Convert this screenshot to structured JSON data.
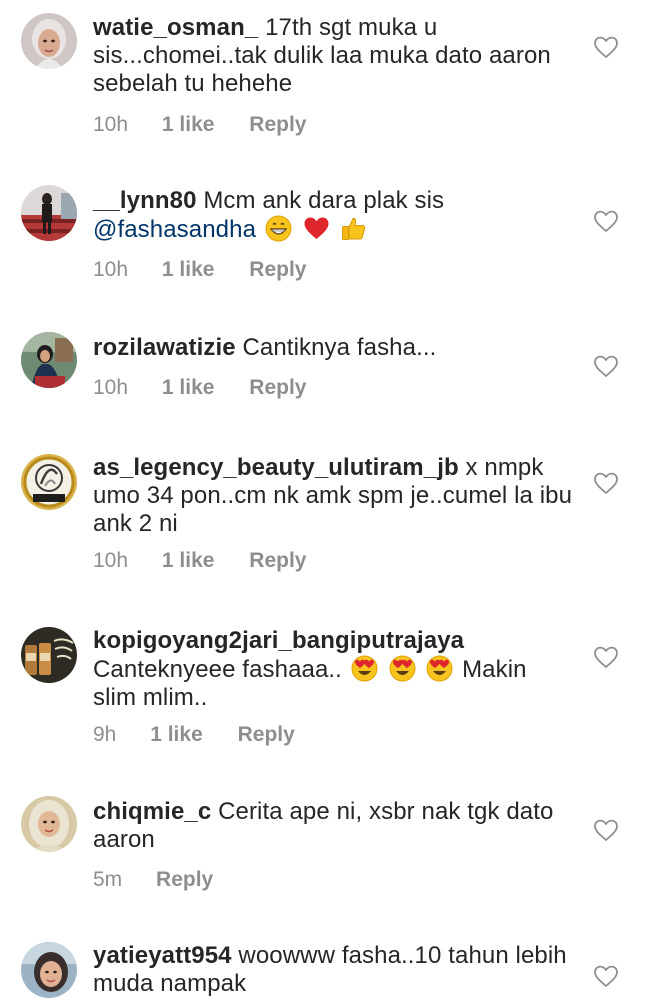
{
  "icons": {
    "heart_outline": "heart-outline-icon",
    "heart_red": "red-heart-emoji-icon",
    "grinning": "grinning-face-emoji-icon",
    "thumbs_up": "thumbs-up-emoji-icon",
    "heart_eyes": "heart-eyes-emoji-icon"
  },
  "colors": {
    "text": "#262626",
    "muted": "#8e8e8e",
    "mention": "#003569",
    "heart_outline": "#8e8e8e"
  },
  "comments": [
    {
      "username": "watie_osman_",
      "text": "17th sgt muka u sis...chomei..tak dulik laa muka dato aaron sebelah tu hehehe",
      "time": "10h",
      "likes": "1 like",
      "reply": "Reply"
    },
    {
      "username": "__lynn80",
      "text": "Mcm ank dara plak sis",
      "mention": "@fashasandha",
      "time": "10h",
      "likes": "1 like",
      "reply": "Reply"
    },
    {
      "username": "rozilawatizie",
      "text": "Cantiknya fasha...",
      "time": "10h",
      "likes": "1 like",
      "reply": "Reply"
    },
    {
      "username": "as_legency_beauty_ulutiram_jb",
      "text": "x nmpk umo 34 pon..cm nk amk spm je..cumel la ibu ank 2 ni",
      "time": "10h",
      "likes": "1 like",
      "reply": "Reply",
      "avatar_badge": "TEAM FYDA"
    },
    {
      "username": "kopigoyang2jari_bangiputrajaya",
      "text": "Canteknyeee fashaaa..",
      "text_after": "Makin slim mlim..",
      "time": "9h",
      "likes": "1 like",
      "reply": "Reply"
    },
    {
      "username": "chiqmie_c",
      "text": "Cerita ape ni, xsbr nak tgk dato aaron",
      "time": "5m",
      "reply": "Reply"
    },
    {
      "username": "yatieyatt954",
      "text": "woowww fasha..10 tahun lebih muda nampak"
    }
  ]
}
